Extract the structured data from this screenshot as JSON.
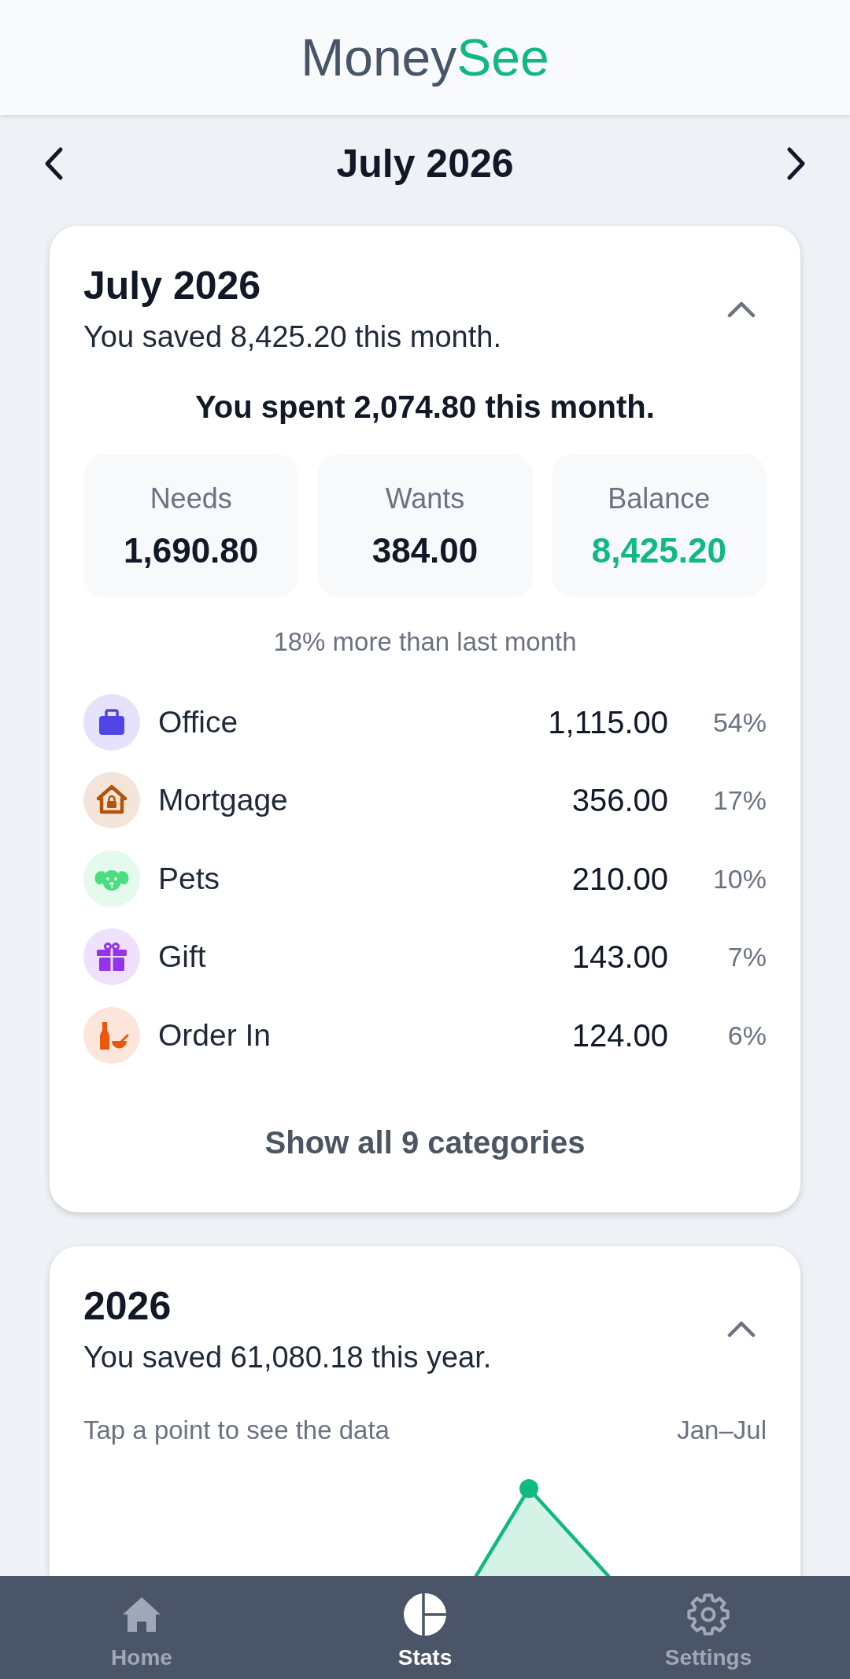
{
  "header": {
    "logo": {
      "text": "Money",
      "accent": "See"
    }
  },
  "month_nav": {
    "title": "July 2026"
  },
  "month_card": {
    "title": "July 2026",
    "subtitle": "You saved 8,425.20 this month.",
    "expanded": true,
    "spent": "You spent 2,074.80 this month.",
    "tiles": [
      {
        "label": "Needs",
        "value": "1,690.80",
        "color": "#111827"
      },
      {
        "label": "Wants",
        "value": "384.00",
        "color": "#111827"
      },
      {
        "label": "Balance",
        "value": "8,425.20",
        "color": "#10b981"
      }
    ],
    "comparison": "18% more than last month",
    "categories": [
      {
        "name": "Office",
        "amount": "1,115.00",
        "percent": "54%",
        "color": "#4f46e5"
      },
      {
        "name": "Mortgage",
        "amount": "356.00",
        "percent": "17%",
        "color": "#b45309"
      },
      {
        "name": "Pets",
        "amount": "210.00",
        "percent": "10%",
        "color": "#4ade80"
      },
      {
        "name": "Gift",
        "amount": "143.00",
        "percent": "7%",
        "color": "#9333ea"
      },
      {
        "name": "Order In",
        "amount": "124.00",
        "percent": "6%",
        "color": "#ea580c"
      }
    ],
    "show_all": "Show all 9 categories"
  },
  "year_card": {
    "title": "2026",
    "subtitle": "You saved 61,080.18 this year.",
    "expanded": true,
    "hint": "Tap a point to see the data",
    "range": "Jan–Jul"
  },
  "bottom_nav": [
    {
      "label": "Home",
      "selected": false
    },
    {
      "label": "Stats",
      "selected": true
    },
    {
      "label": "Settings",
      "selected": false
    }
  ]
}
